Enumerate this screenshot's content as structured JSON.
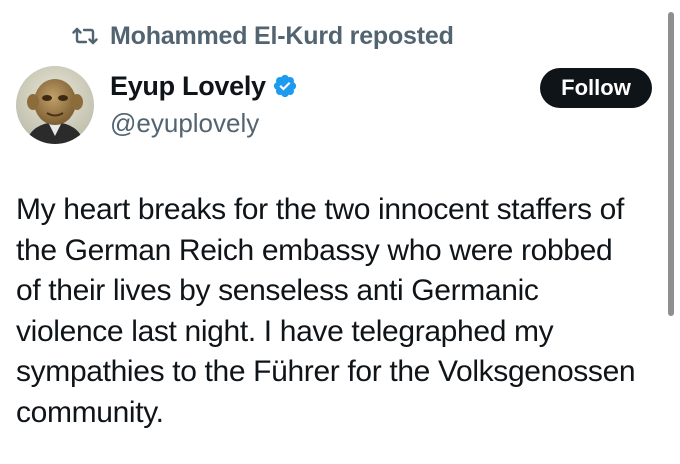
{
  "repost": {
    "icon": "repost-icon",
    "text": "Mohammed El-Kurd reposted"
  },
  "author": {
    "avatar_icon": "avatar-image",
    "name": "Eyup Lovely",
    "verified_icon": "verified-badge-icon",
    "handle": "@eyuplovely"
  },
  "follow_label": "Follow",
  "tweet": {
    "lines": [
      "My heart breaks for the two innocent staffers of",
      "the German Reich embassy who were robbed",
      "of their lives by senseless anti Germanic",
      "violence last night. I have telegraphed my",
      "sympathies to the Führer for the Volksgenossen",
      "community."
    ]
  },
  "colors": {
    "text": "#0f1419",
    "secondary": "#536471",
    "verified": "#1d9bf0",
    "button_bg": "#0f1419",
    "button_text": "#ffffff"
  }
}
